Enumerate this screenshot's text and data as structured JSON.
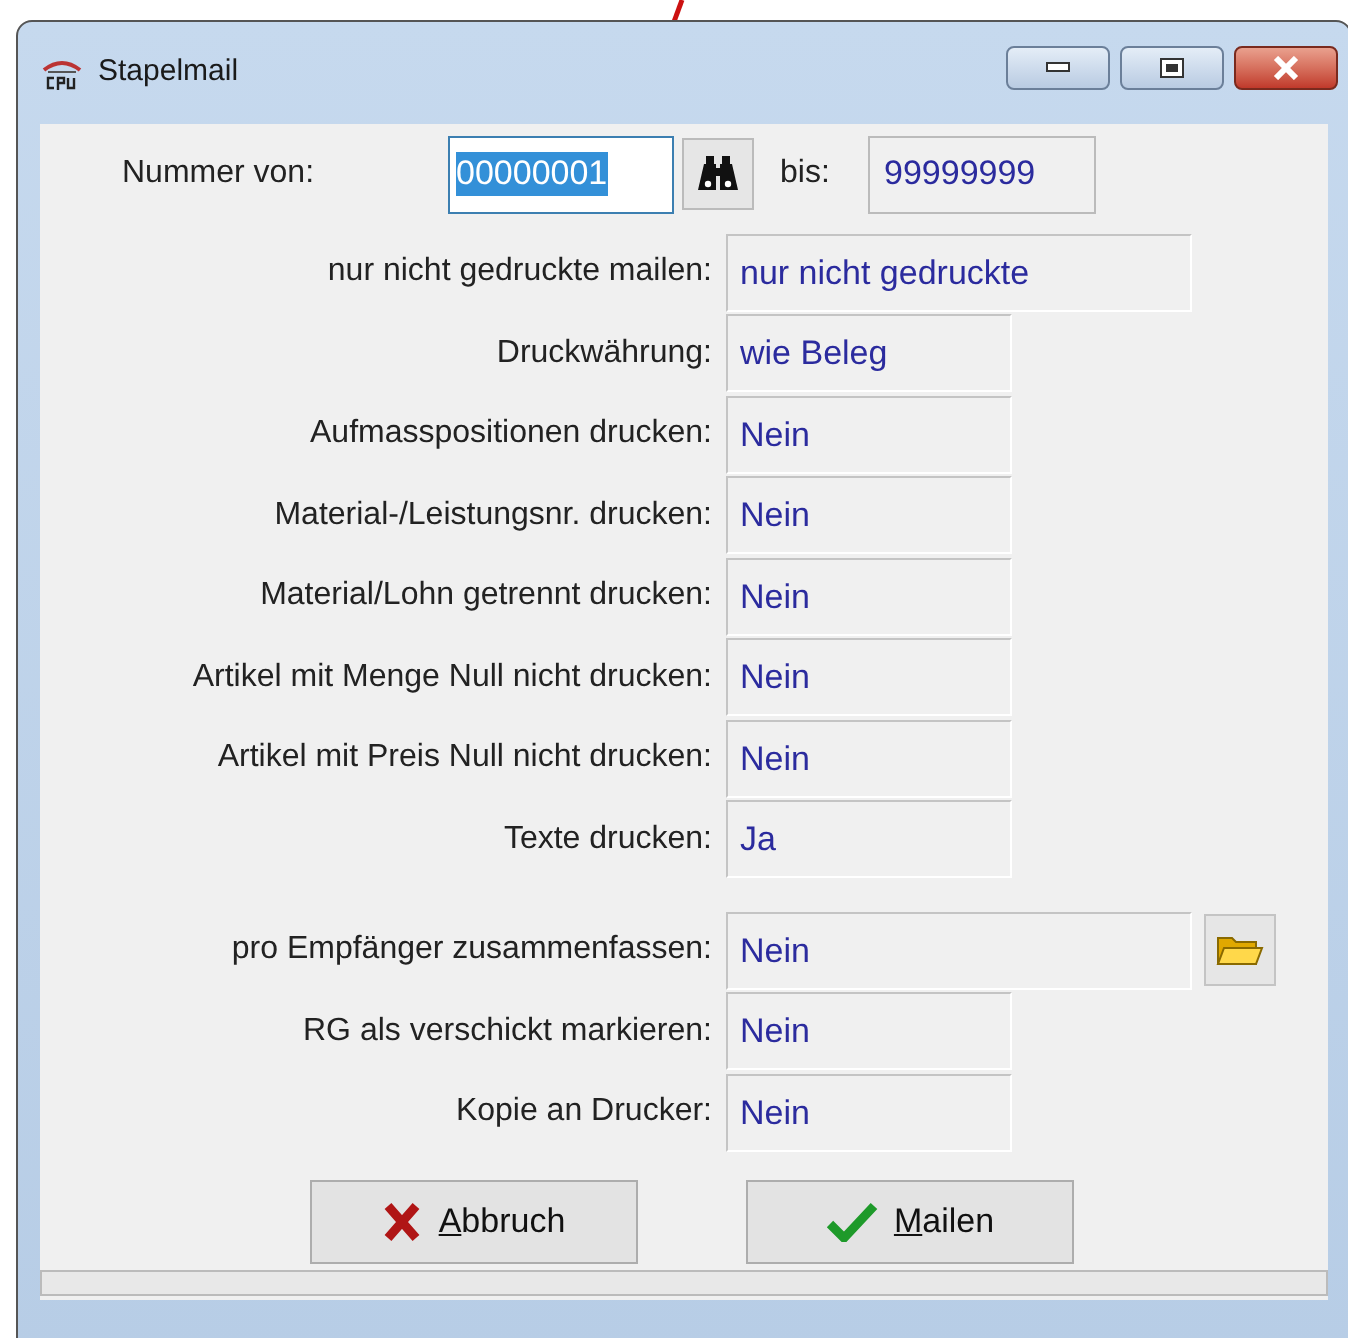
{
  "window": {
    "title": "Stapelmail"
  },
  "range": {
    "from_label": "Nummer von:",
    "from_value": "00000001",
    "from_text_selected": true,
    "to_label": "bis:",
    "to_value": "99999999"
  },
  "option_groups": [
    [
      {
        "label": "nur nicht gedruckte mailen:",
        "value": "nur nicht gedruckte",
        "kind": "wide"
      },
      {
        "label": "Druckwährung:",
        "value": "wie Beleg",
        "kind": "narrow"
      },
      {
        "label": "Aufmasspositionen drucken:",
        "value": "Nein",
        "kind": "narrow"
      },
      {
        "label": "Material-/Leistungsnr. drucken:",
        "value": "Nein",
        "kind": "narrow"
      },
      {
        "label": "Material/Lohn getrennt drucken:",
        "value": "Nein",
        "kind": "narrow"
      },
      {
        "label": "Artikel mit Menge Null nicht drucken:",
        "value": "Nein",
        "kind": "narrow"
      },
      {
        "label": "Artikel mit Preis Null nicht drucken:",
        "value": "Nein",
        "kind": "narrow"
      },
      {
        "label": "Texte drucken:",
        "value": "Ja",
        "kind": "narrow"
      }
    ],
    [
      {
        "label": "pro Empfänger zusammenfassen:",
        "value": "Nein",
        "kind": "browse"
      },
      {
        "label": "RG als verschickt markieren:",
        "value": "Nein",
        "kind": "narrow"
      },
      {
        "label": "Kopie an Drucker:",
        "value": "Nein",
        "kind": "narrow"
      }
    ]
  ],
  "buttons": [
    {
      "label": "Abbruch",
      "kind": "cancel"
    },
    {
      "label": "Mailen",
      "kind": "ok"
    }
  ]
}
